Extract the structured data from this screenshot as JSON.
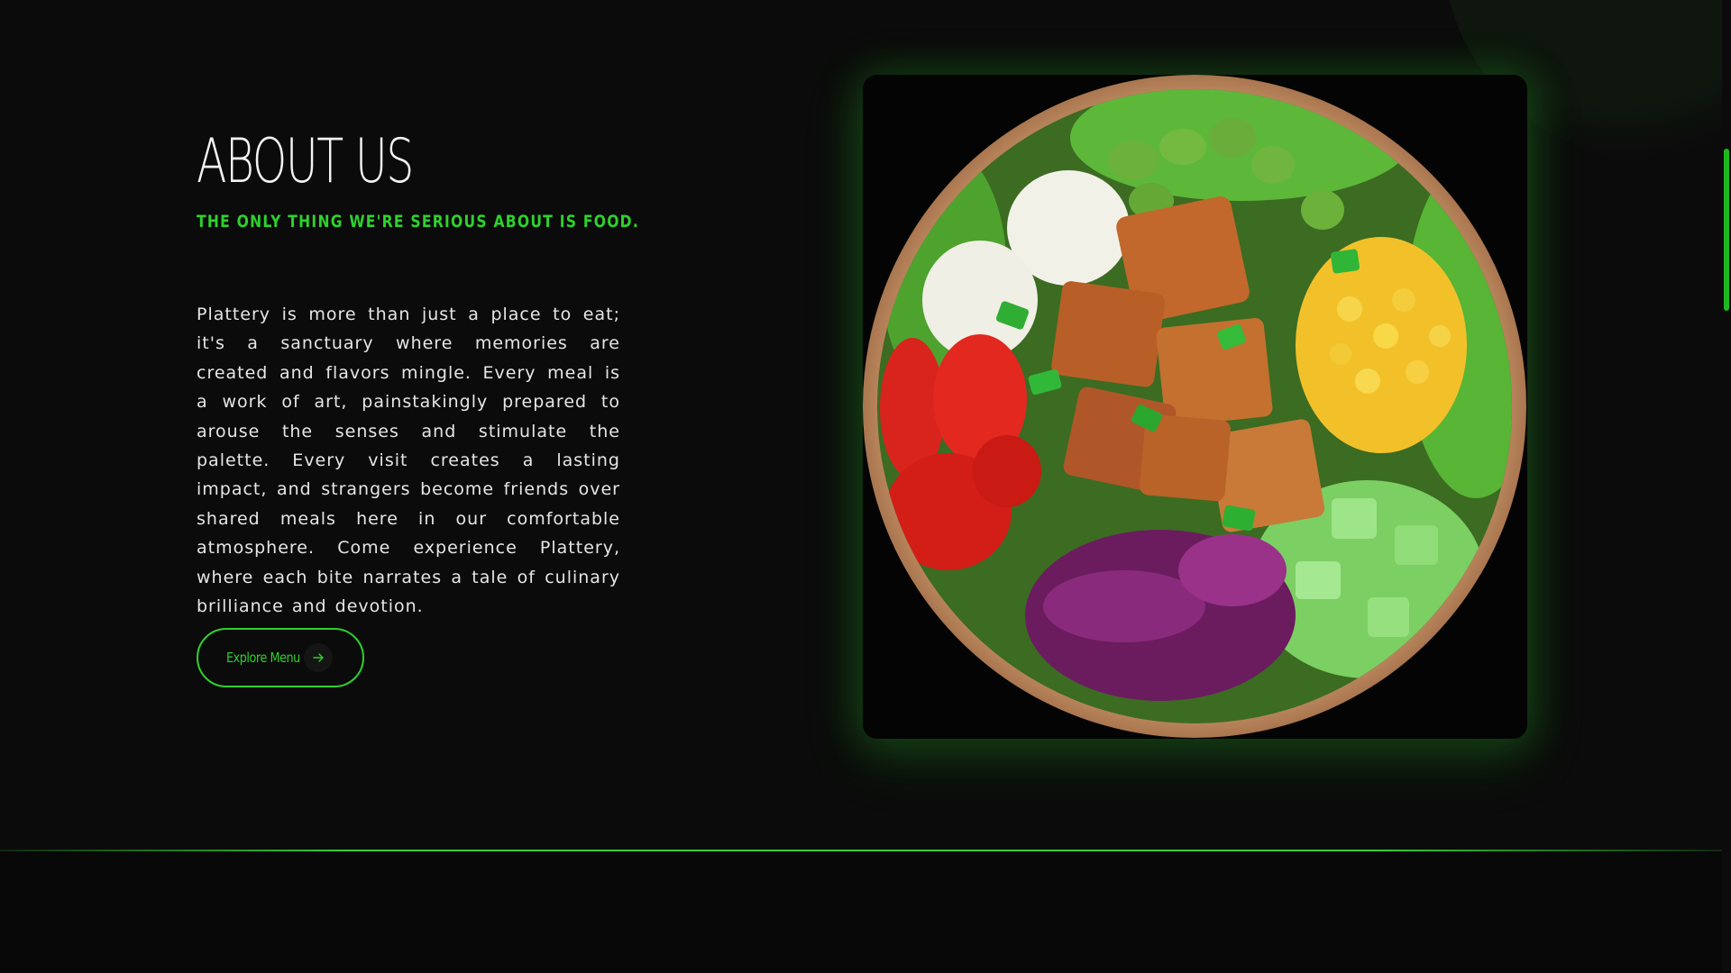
{
  "about": {
    "title": "ABOUT US",
    "subtitle": "THE ONLY THING WE'RE SERIOUS ABOUT IS FOOD.",
    "body": "Plattery is more than just a place to eat; it's a sanctuary where memories are created and flavors mingle. Every meal is a work of art, painstakingly prepared to arouse the senses and stimulate the palette. Every visit creates a lasting impact, and strangers become friends over shared meals here in our comfortable atmosphere. Come experience Plattery, where each bite narrates a tale of culinary brilliance and devotion.",
    "button_label": "Explore Menu",
    "button_icon": "arrow-right-icon"
  },
  "image": {
    "subject": "salad-bowl-image"
  },
  "colors": {
    "accent": "#2ed12e",
    "background": "#0b0b0b",
    "text": "#e6e6e6"
  },
  "scroll": {
    "position_fraction": 0.12
  }
}
